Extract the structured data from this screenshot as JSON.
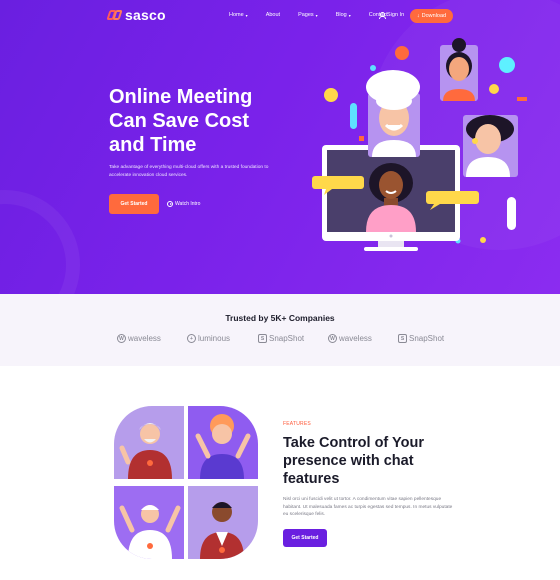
{
  "brand": {
    "name": "sasco"
  },
  "nav": {
    "items": [
      {
        "label": "Home",
        "dropdown": true
      },
      {
        "label": "About",
        "dropdown": false
      },
      {
        "label": "Pages",
        "dropdown": true
      },
      {
        "label": "Blog",
        "dropdown": true
      },
      {
        "label": "Contact",
        "dropdown": false
      }
    ],
    "signin": "Sign In",
    "download": "Download"
  },
  "hero": {
    "title_lines": [
      "Online Meeting",
      "Can Save Cost",
      "and Time"
    ],
    "description": "Take advantage of everything multi-cloud offers with a trusted foundation to accelerate innovation cloud services.",
    "cta": "Get Started",
    "watch": "Watch Intro"
  },
  "trusted": {
    "title": "Trusted by 5K+ Companies",
    "logos": [
      "waveless",
      "luminous",
      "SnapShot",
      "waveless",
      "SnapShot"
    ]
  },
  "features": {
    "label": "FEATURES",
    "title_lines": [
      "Take Control of Your",
      "presence with chat",
      "features"
    ],
    "description": "Nisl orci uni fuscidi velit ut tortor. A condimentum vitae sapien pellentesque habitant. Ut malesuada fames ac turpis egestas sed tempus. In metus vulputate eu scelerisque felis.",
    "cta": "Get Started"
  },
  "colors": {
    "hero_bg": "#7a22ea",
    "accent": "#ff6a3d",
    "primary": "#6a1fe0",
    "label": "#ff5a3a"
  }
}
